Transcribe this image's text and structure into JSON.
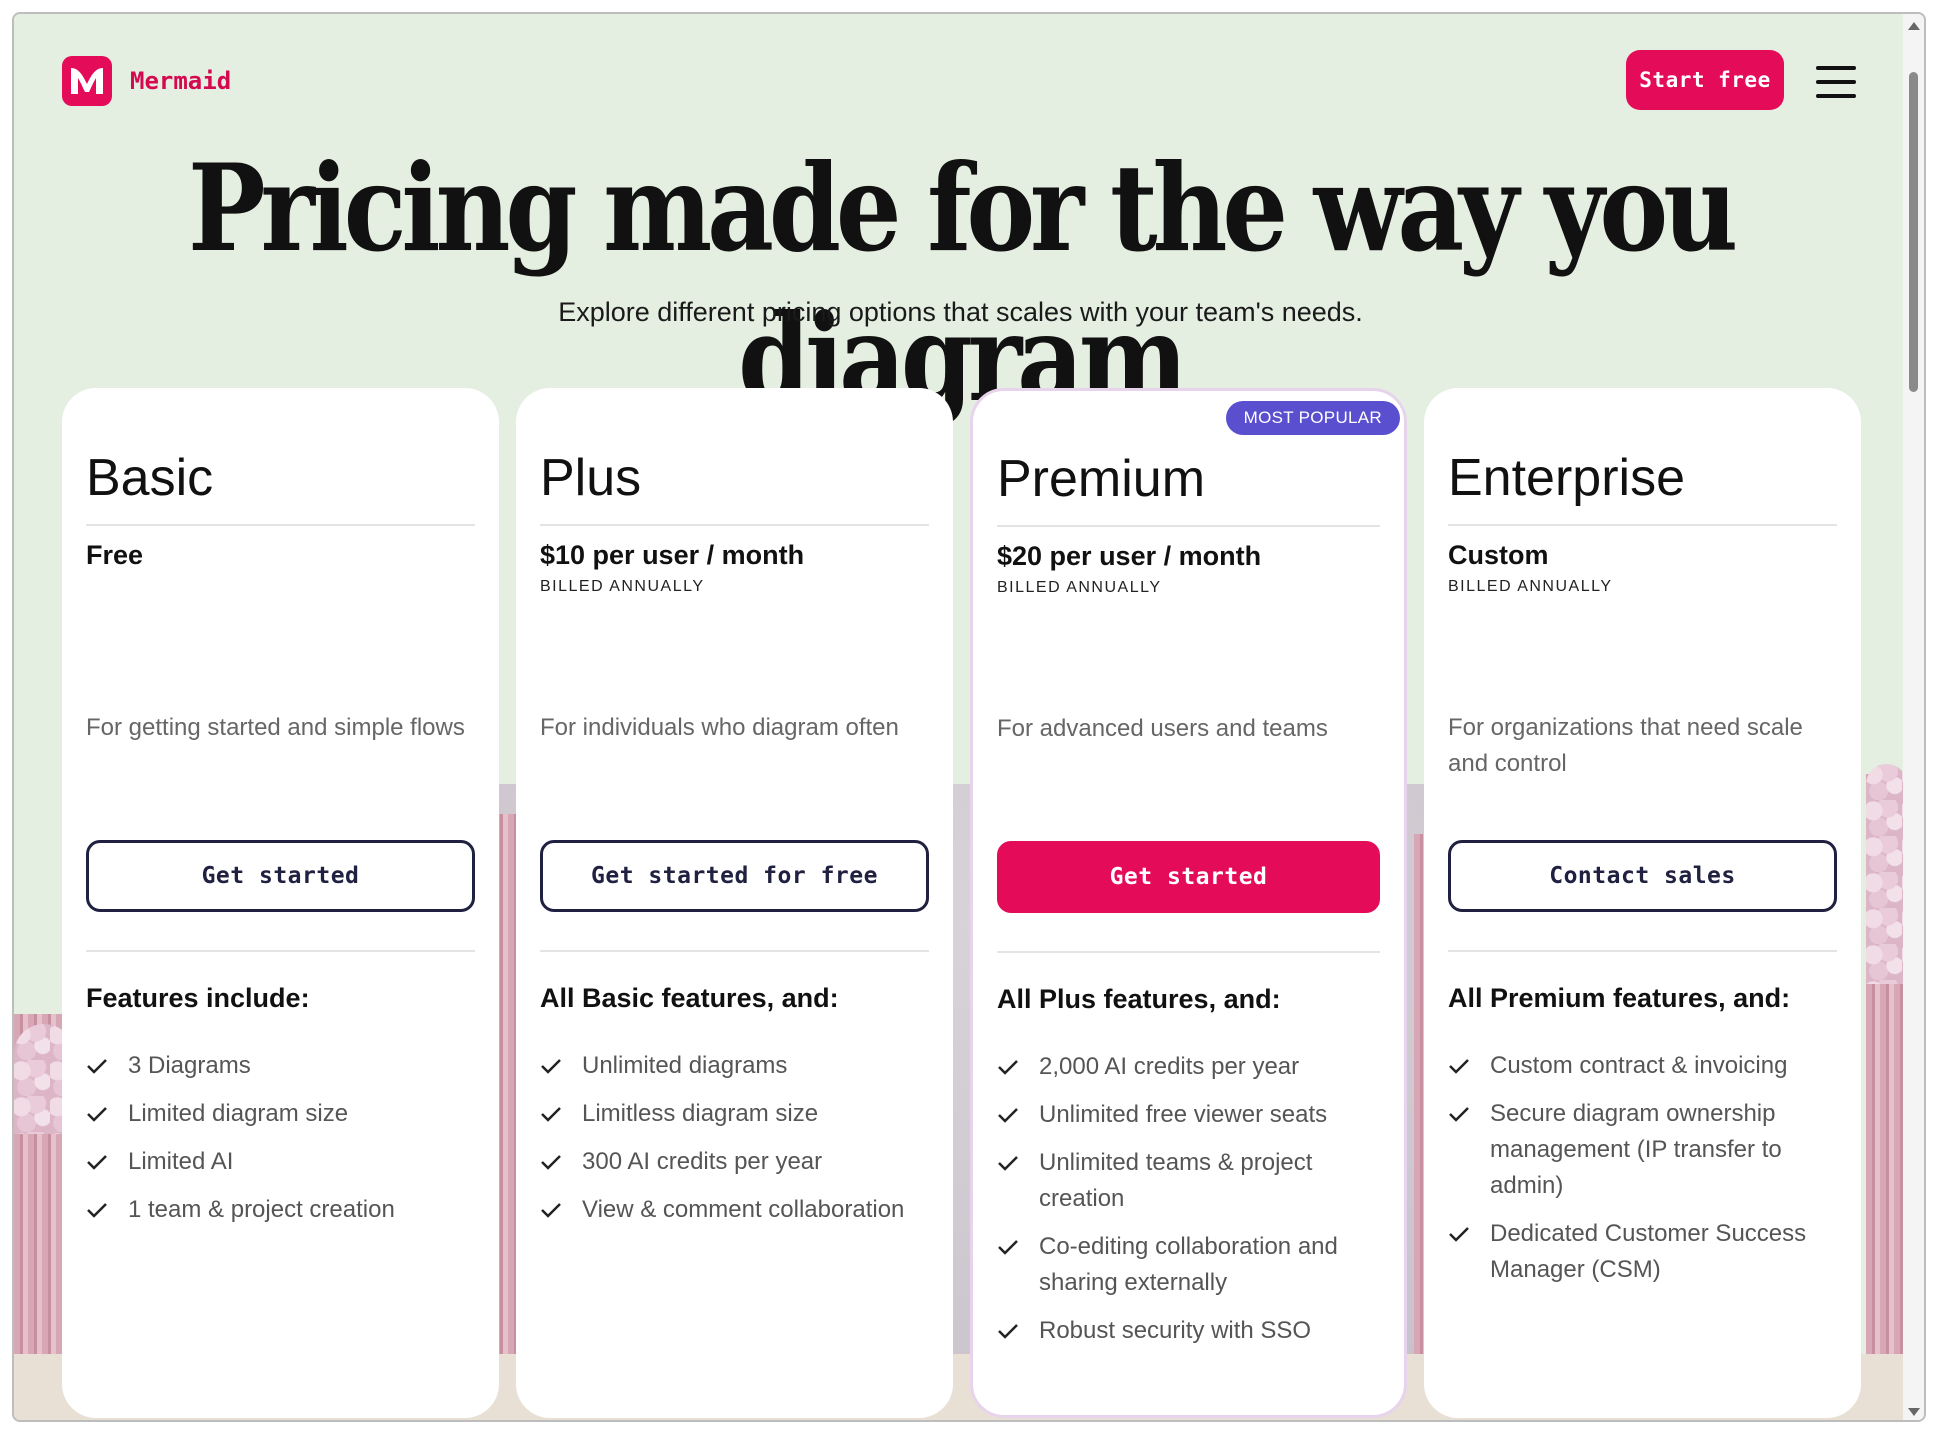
{
  "brand": {
    "name": "Mermaid",
    "accent": "#e40b59"
  },
  "header": {
    "start_label": "Start free"
  },
  "hero": {
    "title": "Pricing made for the way you diagram",
    "subtitle": "Explore different pricing options that scales with your team's needs."
  },
  "plans": [
    {
      "name": "Basic",
      "price": "Free",
      "billing": "",
      "description": "For getting started and simple flows",
      "cta": "Get started",
      "features_heading": "Features include:",
      "features": [
        "3 Diagrams",
        "Limited diagram size",
        "Limited AI",
        "1 team & project creation"
      ]
    },
    {
      "name": "Plus",
      "price": "$10 per user / month",
      "billing": "BILLED ANNUALLY",
      "description": "For individuals who diagram often",
      "cta": "Get started for free",
      "features_heading": "All Basic features, and:",
      "features": [
        "Unlimited diagrams",
        "Limitless diagram size",
        "300 AI credits per year",
        "View & comment collaboration"
      ]
    },
    {
      "name": "Premium",
      "badge": "MOST POPULAR",
      "price": "$20 per user / month",
      "billing": "BILLED ANNUALLY",
      "description": "For advanced users and teams",
      "cta": "Get started",
      "features_heading": "All Plus features, and:",
      "features": [
        "2,000 AI credits per year",
        "Unlimited free viewer seats",
        "Unlimited teams & project creation",
        "Co-editing collaboration and sharing externally",
        "Robust security with SSO"
      ]
    },
    {
      "name": "Enterprise",
      "price": "Custom",
      "billing": "BILLED ANNUALLY",
      "description": "For organizations that need scale and control",
      "cta": "Contact sales",
      "features_heading": "All Premium features, and:",
      "features": [
        "Custom contract & invoicing",
        "Secure diagram ownership management (IP transfer to admin)",
        "Dedicated Customer Success Manager (CSM)"
      ]
    }
  ],
  "icons": {
    "logo": "mermaid-logo-icon",
    "menu": "hamburger-menu-icon",
    "check": "check-icon"
  }
}
